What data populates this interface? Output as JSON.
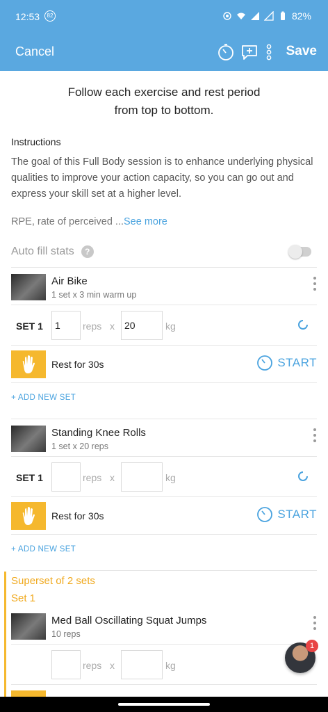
{
  "status_bar": {
    "time": "12:53",
    "notification_count": "82",
    "battery": "82%"
  },
  "app_bar": {
    "cancel_label": "Cancel",
    "save_label": "Save"
  },
  "intro": {
    "line1": "Follow each exercise and rest period",
    "line2": "from top to bottom."
  },
  "instructions": {
    "heading": "Instructions",
    "body": "The goal of this Full Body session is to enhance underlying physical qualities to improve your action capacity, so you can go out and express your skill set at a higher level.",
    "rpe_text": "RPE, rate of perceived ...",
    "see_more": "See more"
  },
  "auto_fill": {
    "label": "Auto fill stats",
    "help": "?"
  },
  "exercises": [
    {
      "name": "Air Bike",
      "detail": "1 set x 3 min warm up",
      "set_label": "SET 1",
      "reps_value": "1",
      "reps_unit": "reps",
      "times": "x",
      "weight_value": "20",
      "weight_unit": "kg",
      "rest_label": "Rest for 30s",
      "start_label": "START",
      "add_set": "+ ADD NEW SET"
    },
    {
      "name": "Standing Knee Rolls",
      "detail": "1 set x 20 reps",
      "set_label": "SET 1",
      "reps_value": "",
      "reps_unit": "reps",
      "times": "x",
      "weight_value": "",
      "weight_unit": "kg",
      "rest_label": "Rest for 30s",
      "start_label": "START",
      "add_set": "+ ADD NEW SET"
    }
  ],
  "superset": {
    "title": "Superset of 2 sets",
    "set_title": "Set 1",
    "exercise": {
      "name": "Med Ball Oscillating Squat Jumps",
      "detail": "10 reps",
      "reps_unit": "reps",
      "times": "x",
      "weight_unit": "kg"
    }
  },
  "chat": {
    "badge": "1"
  },
  "colors": {
    "primary": "#5aa8e0",
    "accent": "#4aa3df",
    "rest": "#f5b82e",
    "superset": "#f0a91e"
  }
}
